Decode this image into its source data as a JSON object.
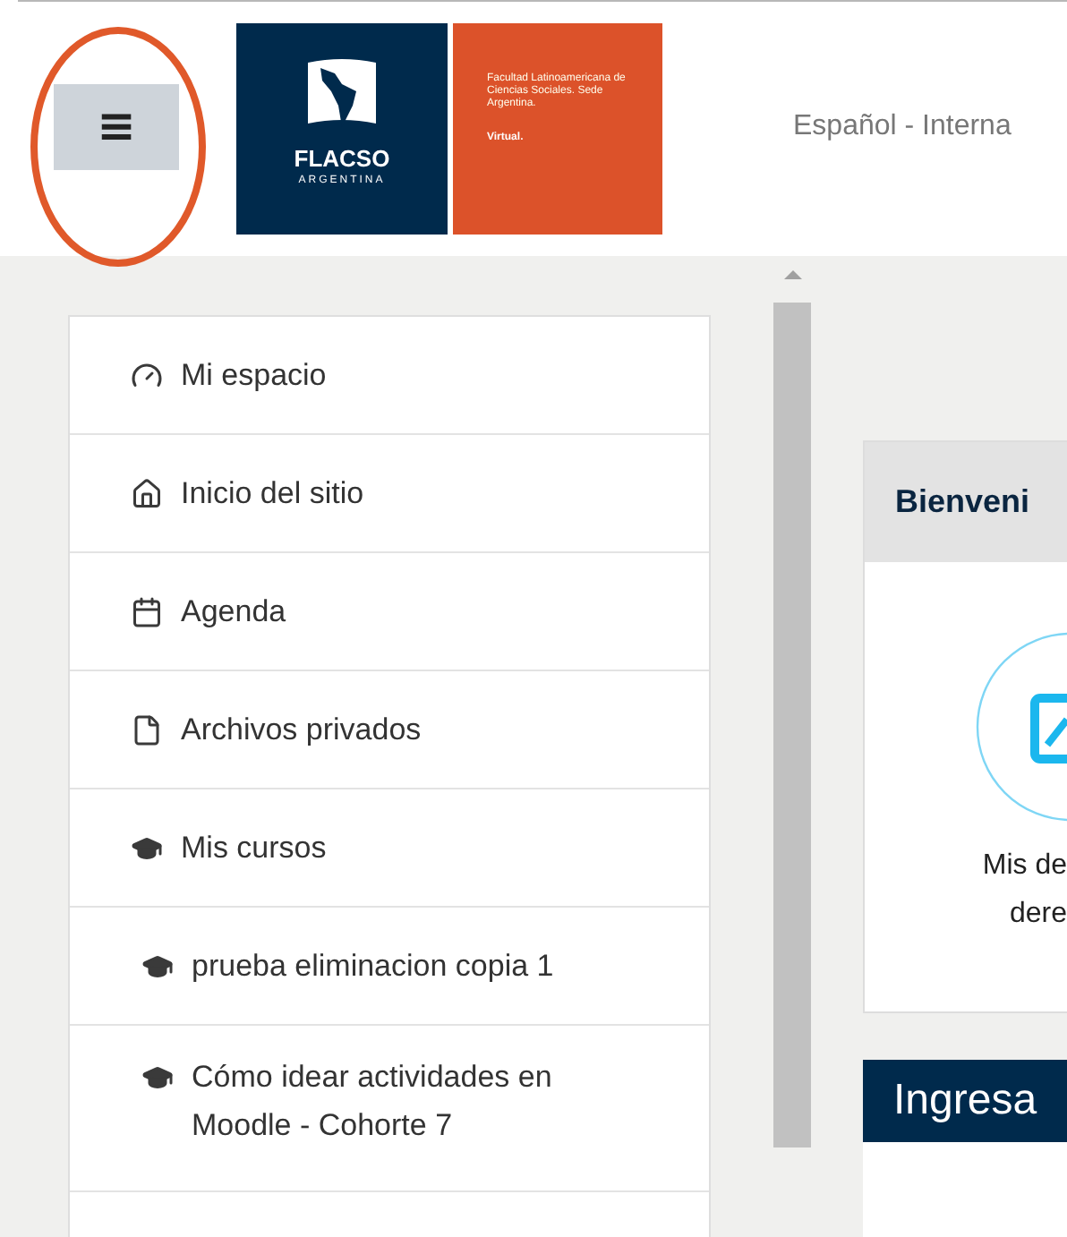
{
  "header": {
    "menu_button": {
      "label": "≡"
    },
    "logo": {
      "name": "FLACSO",
      "country": "ARGENTINA",
      "institution": "Facultad Latinoamericana de Ciencias Sociales. Sede Argentina.",
      "tagline": "Virtual."
    },
    "language": "Español - Interna"
  },
  "nav": [
    {
      "label": "Mi espacio"
    },
    {
      "label": "Inicio del sitio"
    },
    {
      "label": "Agenda"
    },
    {
      "label": "Archivos privados"
    },
    {
      "label": "Mis cursos",
      "children": [
        {
          "label": "prueba eliminacion copia 1"
        },
        {
          "label": "Cómo idear actividades en Moodle - Cohorte 7"
        }
      ]
    }
  ],
  "welcome_card": {
    "title": "Bienveni",
    "caption": "Mis de\ndere"
  },
  "login_card": {
    "title": "Ingresa"
  }
}
